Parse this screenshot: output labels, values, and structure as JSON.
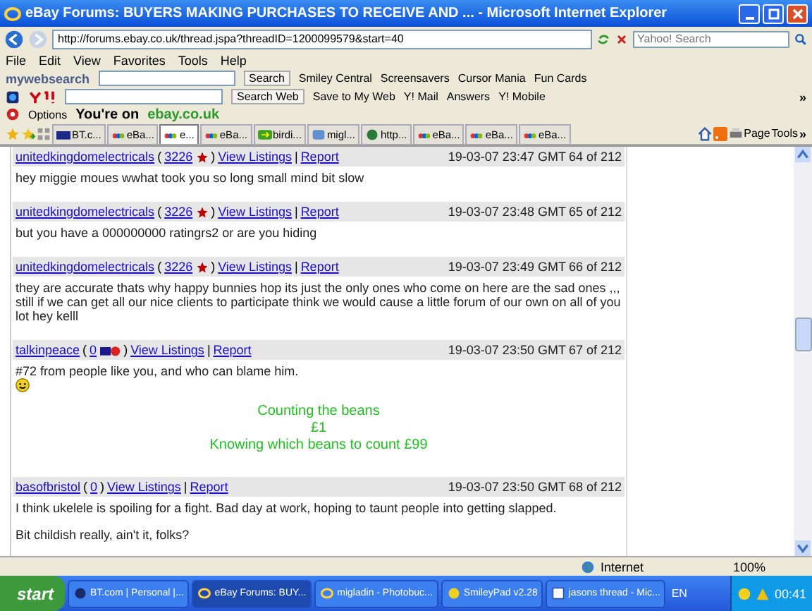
{
  "window": {
    "title": "eBay Forums: BUYERS MAKING PURCHASES TO RECEIVE AND ... - Microsoft Internet Explorer"
  },
  "address": {
    "url": "http://forums.ebay.co.uk/thread.jspa?threadID=1200099579&start=40",
    "search_placeholder": "Yahoo! Search"
  },
  "menu": [
    "File",
    "Edit",
    "View",
    "Favorites",
    "Tools",
    "Help"
  ],
  "mywebsearch": {
    "label": "mywebsearch",
    "button": "Search",
    "links": [
      "Smiley Central",
      "Screensavers",
      "Cursor Mania",
      "Fun Cards"
    ]
  },
  "yahoo_toolbar": {
    "search_button": "Search Web",
    "items": [
      "Save to My Web",
      "Y! Mail",
      "Answers",
      "Y! Mobile"
    ],
    "more": "»"
  },
  "ebay_bar": {
    "options": "Options",
    "prefix": "You're on",
    "site": "ebay.co.uk"
  },
  "tabs": [
    {
      "label": "BT.c...",
      "kind": "bt",
      "selected": false
    },
    {
      "label": "eBa...",
      "kind": "ebay",
      "selected": false
    },
    {
      "label": "e...",
      "kind": "ebay",
      "selected": true
    },
    {
      "label": "eBa...",
      "kind": "ebay",
      "selected": false
    },
    {
      "label": "birdi...",
      "kind": "arrow",
      "selected": false
    },
    {
      "label": "migl...",
      "kind": "photo",
      "selected": false
    },
    {
      "label": "http...",
      "kind": "globe",
      "selected": false
    },
    {
      "label": "eBa...",
      "kind": "ebay",
      "selected": false
    },
    {
      "label": "eBa...",
      "kind": "ebay",
      "selected": false
    },
    {
      "label": "eBa...",
      "kind": "ebay",
      "selected": false
    }
  ],
  "command_bar": {
    "page": "Page",
    "tools": "Tools",
    "more": "»"
  },
  "posts": [
    {
      "user": "unitedkingdomelectricals",
      "open": "(",
      "rating": "3226",
      "kind": "star",
      "close": ")",
      "links": [
        "View Listings",
        "Report"
      ],
      "sep": "|",
      "time": "19-03-07 23:47 GMT",
      "number": "64 of 212",
      "body": [
        "hey miggie moues wwhat took you so long small mind bit slow"
      ]
    },
    {
      "user": "unitedkingdomelectricals",
      "open": "(",
      "rating": "3226",
      "kind": "star",
      "close": ")",
      "links": [
        "View Listings",
        "Report"
      ],
      "sep": "|",
      "time": "19-03-07 23:48 GMT",
      "number": "65 of 212",
      "body": [
        "but you have a 000000000 ratingrs2 or are you hiding"
      ]
    },
    {
      "user": "unitedkingdomelectricals",
      "open": "(",
      "rating": "3226",
      "kind": "star",
      "close": ")",
      "links": [
        "View Listings",
        "Report"
      ],
      "sep": "|",
      "time": "19-03-07 23:49 GMT",
      "number": "66 of 212",
      "body": [
        "they are accurate thats why happy bunnies hop its just the only ones who come on here are the sad ones ,,, still if we can get all our nice clients to participate think we would cause a little forum of our own on all of you lot hey kelll"
      ]
    },
    {
      "user": "talkinpeace",
      "open": "(",
      "rating": "0",
      "kind": "member",
      "close": ")",
      "links": [
        "View Listings",
        "Report"
      ],
      "sep": "|",
      "time": "19-03-07 23:50 GMT",
      "number": "67 of 212",
      "body": [
        "#72 from people like you, and who can blame him."
      ],
      "smiley": true,
      "green_lines": [
        "Counting the beans",
        "£1",
        "Knowing which beans to count £99"
      ]
    },
    {
      "user": "basofbristol",
      "open": "(",
      "rating": "0",
      "kind": "plain",
      "close": ")",
      "links": [
        "View Listings",
        "Report"
      ],
      "sep": "|",
      "time": "19-03-07 23:50 GMT",
      "number": "68 of 212",
      "body": [
        "I think ukelele is spoiling for a fight. Bad day at work, hoping to taunt people into getting slapped.",
        "Bit childish really, ain't it, folks?"
      ]
    }
  ],
  "status_bar": {
    "zone": "Internet",
    "zoom": "100%"
  },
  "taskbar": {
    "start": "start",
    "items": [
      {
        "label": "BT.com | Personal |...",
        "kind": "bt",
        "selected": false
      },
      {
        "label": "eBay Forums: BUY...",
        "kind": "ie",
        "selected": true
      },
      {
        "label": "migladin - Photobuc...",
        "kind": "ie",
        "selected": false
      },
      {
        "label": "SmileyPad v2.28",
        "kind": "smiley",
        "selected": false
      },
      {
        "label": "jasons thread - Mic...",
        "kind": "word",
        "selected": false
      }
    ],
    "language": "EN",
    "clock": "00:41"
  }
}
